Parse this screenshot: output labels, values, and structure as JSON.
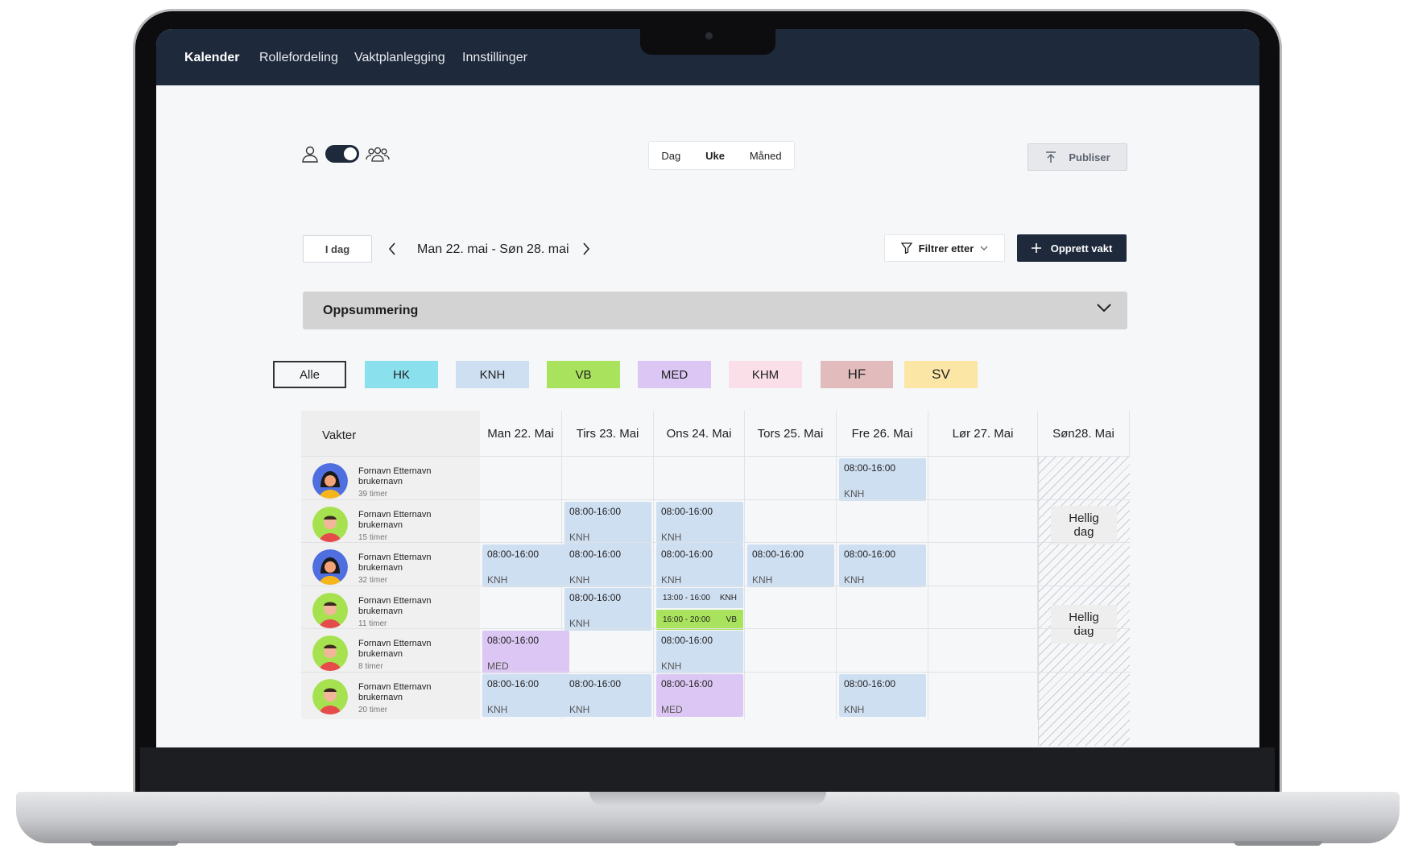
{
  "nav": {
    "items": [
      {
        "label": "Kalender",
        "active": true
      },
      {
        "label": "Rollefordeling"
      },
      {
        "label": "Vaktplanlegging"
      },
      {
        "label": "Innstillinger"
      }
    ]
  },
  "mode_toggle": {
    "left_icon": "person-icon",
    "right_icon": "group-icon",
    "state": "group"
  },
  "view": {
    "options": [
      "Dag",
      "Uke",
      "Måned"
    ],
    "selected": "Uke"
  },
  "publish": {
    "label": "Publiser",
    "icon": "upload-icon"
  },
  "navigation": {
    "today_label": "I dag",
    "range": "Man 22. mai - Søn 28. mai"
  },
  "filter": {
    "label": "Filtrer etter",
    "icon": "funnel-icon"
  },
  "create": {
    "label": "Opprett vakt",
    "icon": "plus-icon"
  },
  "summary": {
    "label": "Oppsummering"
  },
  "chips": [
    {
      "label": "Alle",
      "color": "#ffffff"
    },
    {
      "label": "HK",
      "color": "#8be0ee"
    },
    {
      "label": "KNH",
      "color": "#cfdff2"
    },
    {
      "label": "VB",
      "color": "#a9e35d"
    },
    {
      "label": "MED",
      "color": "#dcc6f3"
    },
    {
      "label": "KHM",
      "color": "#fbdfe8"
    },
    {
      "label": "HF",
      "color": "#e2bcbc"
    },
    {
      "label": "SV",
      "color": "#fbe6a6"
    }
  ],
  "table": {
    "first_header": "Vakter",
    "days": [
      "Man 22. Mai",
      "Tirs 23. Mai",
      "Ons 24. Mai",
      "Tors 25. Mai",
      "Fre 26. Mai",
      "Lør 27. Mai",
      "Søn28. Mai"
    ],
    "holiday_label_1": "Hellig",
    "holiday_label_2": "dag",
    "rows": [
      {
        "name": "Fornavn Etternavn",
        "user": "brukernavn",
        "hours": "39 timer",
        "avatar": "woman",
        "shifts": [
          null,
          null,
          null,
          null,
          {
            "time": "08:00-16:00",
            "role": "KNH"
          },
          null
        ]
      },
      {
        "name": "Fornavn Etternavn",
        "user": "brukernavn",
        "hours": "15 timer",
        "avatar": "man",
        "shifts": [
          null,
          {
            "time": "08:00-16:00",
            "role": "KNH"
          },
          {
            "time": "08:00-16:00",
            "role": "KNH"
          },
          null,
          null,
          null
        ]
      },
      {
        "name": "Fornavn Etternavn",
        "user": "brukernavn",
        "hours": "32 timer",
        "avatar": "woman",
        "shifts": [
          {
            "time": "08:00-16:00",
            "role": "KNH"
          },
          {
            "time": "08:00-16:00",
            "role": "KNH"
          },
          {
            "time": "08:00-16:00",
            "role": "KNH"
          },
          {
            "time": "08:00-16:00",
            "role": "KNH"
          },
          {
            "time": "08:00-16:00",
            "role": "KNH"
          },
          null
        ]
      },
      {
        "name": "Fornavn Etternavn",
        "user": "brukernavn",
        "hours": "11 timer",
        "avatar": "man",
        "shifts": [
          null,
          {
            "time": "08:00-16:00",
            "role": "KNH"
          },
          {
            "split": [
              {
                "time": "13:00 - 16:00",
                "role": "KNH"
              },
              {
                "time": "16:00 - 20:00",
                "role": "VB"
              }
            ]
          },
          null,
          null,
          null
        ]
      },
      {
        "name": "Fornavn Etternavn",
        "user": "brukernavn",
        "hours": "8 timer",
        "avatar": "man",
        "shifts": [
          {
            "time": "08:00-16:00",
            "role": "MED"
          },
          null,
          {
            "time": "08:00-16:00",
            "role": "KNH"
          },
          null,
          null,
          null
        ]
      },
      {
        "name": "Fornavn Etternavn",
        "user": "brukernavn",
        "hours": "20 timer",
        "avatar": "man",
        "shifts": [
          {
            "time": "08:00-16:00",
            "role": "KNH"
          },
          {
            "time": "08:00-16:00",
            "role": "KNH"
          },
          {
            "time": "08:00-16:00",
            "role": "MED"
          },
          null,
          {
            "time": "08:00-16:00",
            "role": "KNH"
          },
          null
        ]
      }
    ]
  }
}
